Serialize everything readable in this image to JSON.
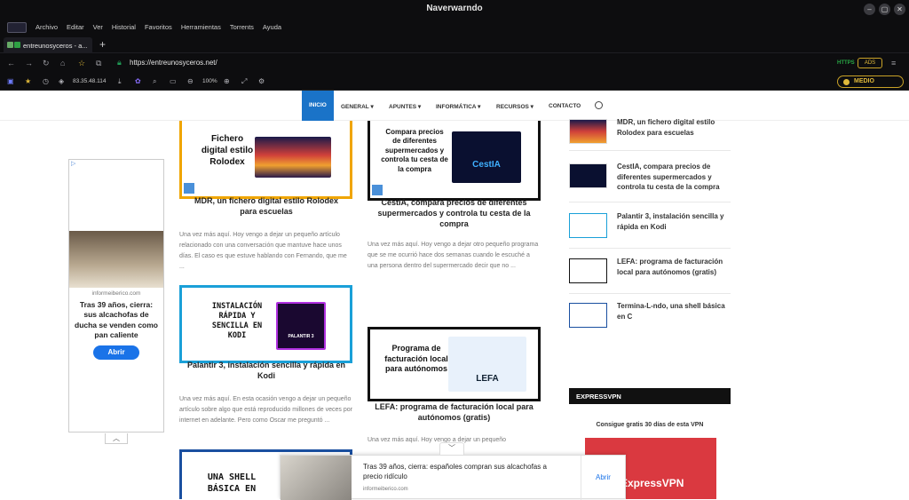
{
  "window": {
    "title": "Naverwarndo"
  },
  "menu": [
    "Archivo",
    "Editar",
    "Ver",
    "Historial",
    "Favoritos",
    "Herramientas",
    "Torrents",
    "Ayuda"
  ],
  "tab": {
    "label": "entreunosyceros - a..."
  },
  "address": {
    "url": "https://entreunosyceros.net/",
    "https_badge": "HTTPS",
    "ads_badge": "ADS"
  },
  "toolbar": {
    "ip": "83.35.48.114",
    "zoom": "100%",
    "security_level": "MEDIO"
  },
  "sitenav": {
    "items": [
      "INICIO",
      "GENERAL",
      "APUNTES",
      "INFORMÁTICA",
      "RECURSOS",
      "CONTACTO"
    ]
  },
  "posts": [
    {
      "thumb_text": "Fichero digital estilo Rolodex",
      "title": "MDR, un fichero digital estilo Rolodex para escuelas",
      "excerpt": "Una vez más aquí. Hoy vengo a dejar un pequeño artículo relacionado con una conversación que mantuve hace unos días. El caso es que estuve hablando con Fernando, que me ...",
      "color": "#f0a500"
    },
    {
      "thumb_text": "Compara precios de diferentes supermercados y controla tu cesta de la compra",
      "title": "CestIA, compara precios de diferentes supermercados y controla tu cesta de la compra",
      "excerpt": "Una vez más aquí. Hoy vengo a dejar otro pequeño programa que se me ocurrió hace dos semanas cuando le escuché a una persona dentro del supermercado decir que no ...",
      "color": "#111111",
      "thumb_label": "CestIA"
    },
    {
      "thumb_text": "INSTALACIÓN RÁPIDA Y SENCILLA EN KODI",
      "title": "Palantir 3, instalación sencilla y rápida en Kodi",
      "excerpt": "Una vez más aquí. En esta ocasión vengo a dejar un pequeño artículo sobre algo que está reproducido millones de veces por internet en adelante. Pero como Oscar me preguntó ...",
      "color": "#1aa0d8",
      "thumb_label": "PALANTIR 3"
    },
    {
      "thumb_text": "Programa de facturación local para autónomos",
      "title": "LEFA: programa de facturación local para autónomos (gratis)",
      "excerpt": "Una vez más aquí. Hoy vengo a dejar un pequeño",
      "color": "#111111",
      "thumb_label": "LEFA"
    },
    {
      "thumb_text": "UNA SHELL BÁSICA EN",
      "color": "#1a4fa0"
    }
  ],
  "sidebar": {
    "items": [
      "MDR, un fichero digital estilo Rolodex para escuelas",
      "CestIA, compara precios de diferentes supermercados y controla tu cesta de la compra",
      "Palantir 3, instalación sencilla y rápida en Kodi",
      "LEFA: programa de facturación local para autónomos (gratis)",
      "Termina-L-ndo, una shell básica en C"
    ],
    "vpn_header": "EXPRESSVPN",
    "vpn_text": "Consigue gratis 30 días de esta VPN",
    "vpn_brand": "ExpressVPN"
  },
  "ad_left": {
    "source": "informeiberico.com",
    "headline": "Tras 39 años, cierra: sus alcachofas de ducha se venden como pan caliente",
    "cta": "Abrir"
  },
  "ad_bottom": {
    "headline": "Tras 39 años, cierra: españoles compran sus alcachofas a precio ridículo",
    "source": "informeiberico.com",
    "cta": "Abrir"
  }
}
